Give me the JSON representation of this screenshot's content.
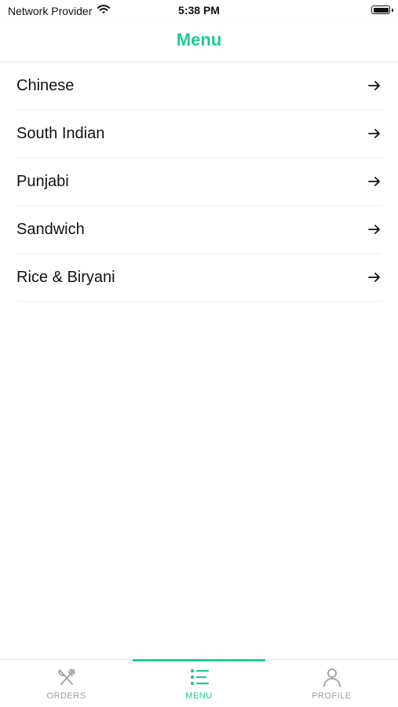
{
  "status_bar": {
    "carrier": "Network Provider",
    "time": "5:38 PM",
    "wifi_icon": "wifi-icon",
    "battery_icon": "battery-icon"
  },
  "header": {
    "title": "Menu"
  },
  "menu": {
    "items": [
      {
        "label": "Chinese",
        "icon": "arrow-right-icon"
      },
      {
        "label": "South Indian",
        "icon": "arrow-right-icon"
      },
      {
        "label": "Punjabi",
        "icon": "arrow-right-icon"
      },
      {
        "label": "Sandwich",
        "icon": "arrow-right-icon"
      },
      {
        "label": "Rice & Biryani",
        "icon": "arrow-right-icon"
      }
    ]
  },
  "tab_bar": {
    "tabs": [
      {
        "label": "ORDERS",
        "icon": "fork-knife-icon",
        "active": false
      },
      {
        "label": "MENU",
        "icon": "list-icon",
        "active": true
      },
      {
        "label": "PROFILE",
        "icon": "user-icon",
        "active": false
      }
    ]
  },
  "colors": {
    "accent": "#20c997",
    "text": "#111111",
    "inactive": "#9aa0a8",
    "divider": "#eeeeee"
  }
}
